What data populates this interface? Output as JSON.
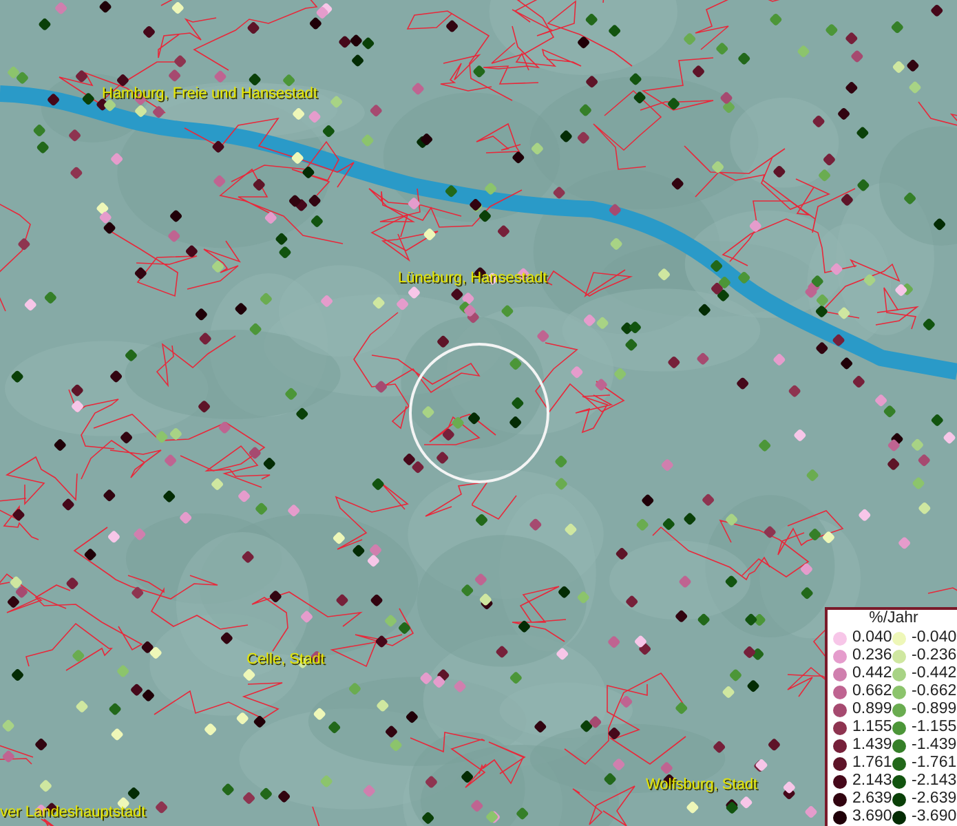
{
  "map": {
    "places": [
      {
        "name": "Hamburg, Freie und Hansestadt"
      },
      {
        "name": "Lüneburg, Hansestadt"
      },
      {
        "name": "Celle, Stadt"
      },
      {
        "name": "Wolfsburg, Stadt"
      },
      {
        "name": "ver Landeshauptstadt"
      }
    ]
  },
  "legend": {
    "title": "%/Jahr",
    "rows": [
      {
        "positive": {
          "label": "0.040",
          "color": "#f7c6e8"
        },
        "negative": {
          "label": "-0.040",
          "color": "#eef7b8"
        }
      },
      {
        "positive": {
          "label": "0.236",
          "color": "#e59ccc"
        },
        "negative": {
          "label": "-0.236",
          "color": "#cfe7a0"
        }
      },
      {
        "positive": {
          "label": "0.442",
          "color": "#d07fae"
        },
        "negative": {
          "label": "-0.442",
          "color": "#a8d385"
        }
      },
      {
        "positive": {
          "label": "0.662",
          "color": "#bf6491"
        },
        "negative": {
          "label": "-0.662",
          "color": "#8cc46c"
        }
      },
      {
        "positive": {
          "label": "0.899",
          "color": "#a64a70"
        },
        "negative": {
          "label": "-0.899",
          "color": "#6aac50"
        }
      },
      {
        "positive": {
          "label": "1.155",
          "color": "#8e3450"
        },
        "negative": {
          "label": "-1.155",
          "color": "#4c9638"
        }
      },
      {
        "positive": {
          "label": "1.439",
          "color": "#76203a"
        },
        "negative": {
          "label": "-1.439",
          "color": "#357f28"
        }
      },
      {
        "positive": {
          "label": "1.761",
          "color": "#5e1428"
        },
        "negative": {
          "label": "-1.761",
          "color": "#22681a"
        }
      },
      {
        "positive": {
          "label": "2.143",
          "color": "#46081a"
        },
        "negative": {
          "label": "-2.143",
          "color": "#12540f"
        }
      },
      {
        "positive": {
          "label": "2.639",
          "color": "#320410"
        },
        "negative": {
          "label": "-2.639",
          "color": "#0a4008"
        }
      },
      {
        "positive": {
          "label": "3.690",
          "color": "#200008"
        },
        "negative": {
          "label": "-3.690",
          "color": "#042c04"
        }
      }
    ]
  }
}
